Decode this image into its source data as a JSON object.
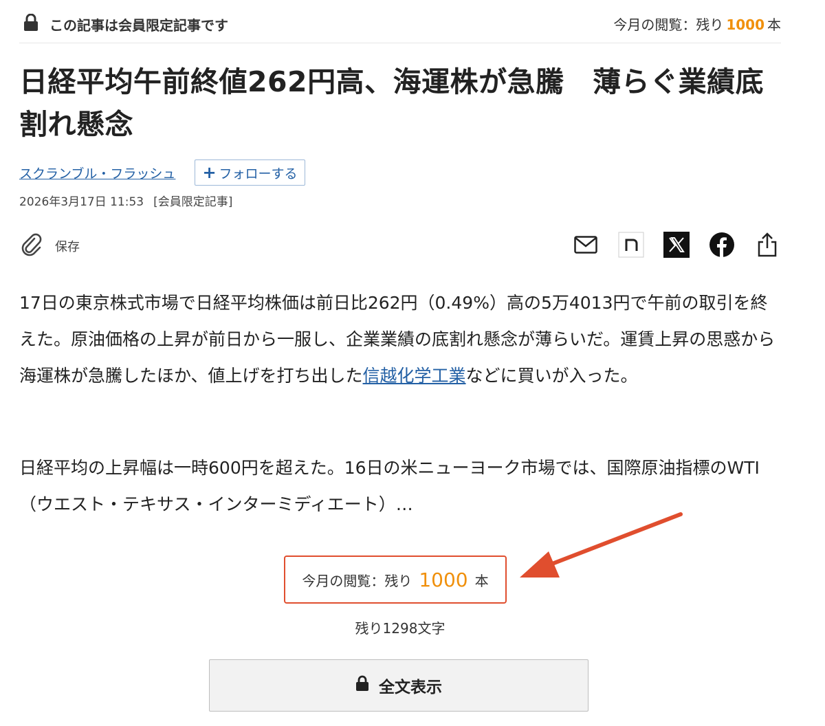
{
  "header": {
    "members_label": "この記事は会員限定記事です",
    "quota_prefix": "今月の閲覧：残り",
    "quota_count": "1000",
    "quota_suffix": "本"
  },
  "article": {
    "title": "日経平均午前終値262円高、海運株が急騰　薄らぐ業績底割れ懸念",
    "series": "スクランブル・フラッシュ",
    "follow_label": "フォローする",
    "date": "2026年3月17日 11:53",
    "tag": "[会員限定記事]",
    "save_label": "保存",
    "p1_before": "17日の東京株式市場で日経平均株価は前日比262円（0.49%）高の5万4013円で午前の取引を終えた。原油価格の上昇が前日から一服し、企業業績の底割れ懸念が薄らいだ。運賃上昇の思惑から海運株が急騰したほか、値上げを打ち出した",
    "p1_link": "信越化学工業",
    "p1_after": "などに買いが入った。",
    "p2": "日経平均の上昇幅は一時600円を超えた。16日の米ニューヨーク市場では、国際原油指標のWTI（ウエスト・テキサス・インターミディエート）…"
  },
  "paywall": {
    "quota_prefix": "今月の閲覧：残り",
    "quota_count": "1000",
    "quota_suffix": "本",
    "remaining_chars": "残り1298文字",
    "full_text_label": "全文表示"
  },
  "colors": {
    "accent_orange": "#f0900c",
    "link_blue": "#2360a5",
    "highlight_red": "#e04e2e"
  },
  "icons": [
    "lock-icon",
    "paperclip-icon",
    "mail-icon",
    "note-icon",
    "x-icon",
    "facebook-icon",
    "share-icon",
    "plus-icon"
  ]
}
